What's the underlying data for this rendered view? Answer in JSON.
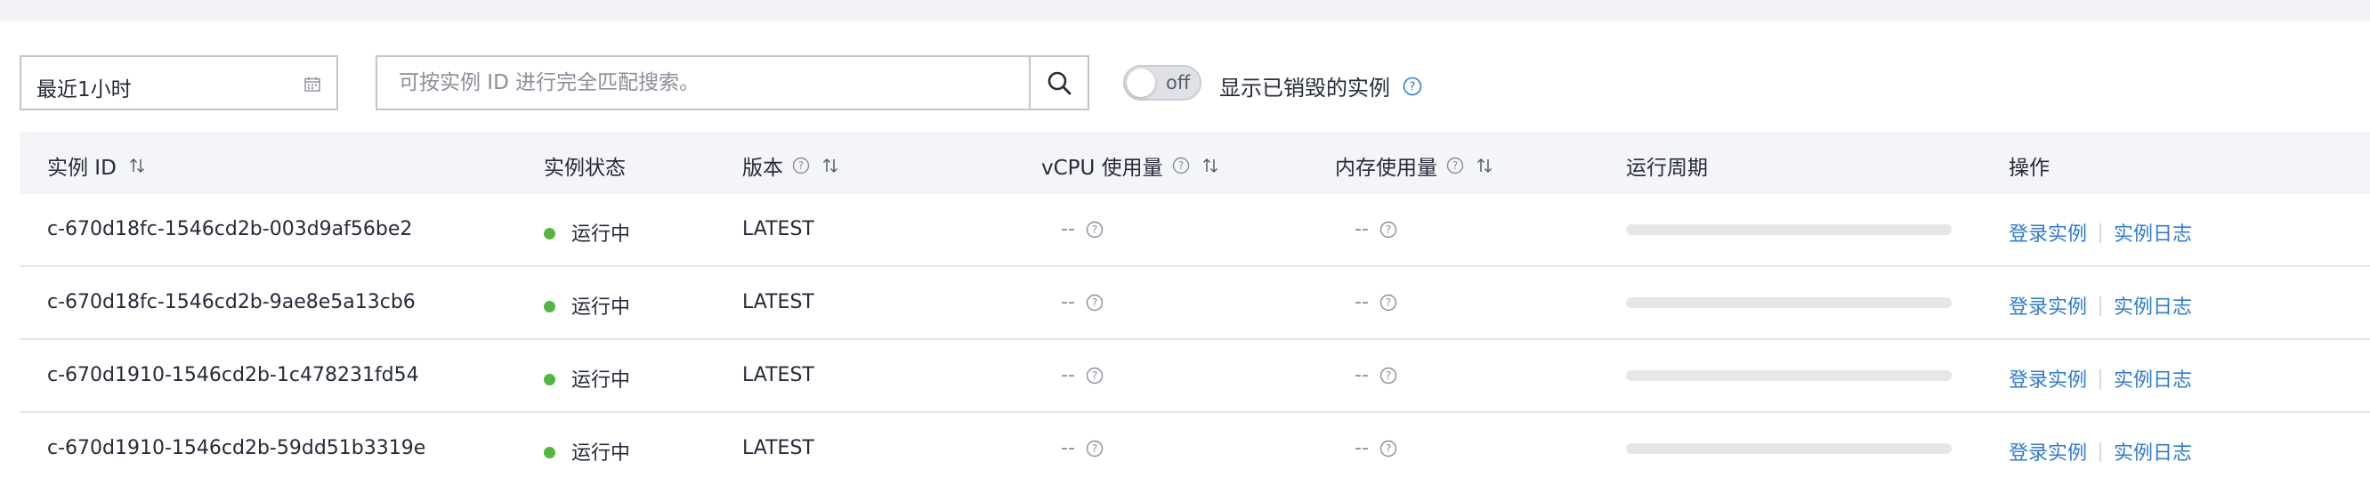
{
  "toolbar": {
    "time_range": "最近1小时",
    "search_placeholder": "可按实例 ID 进行完全匹配搜索。",
    "toggle_text": "off",
    "toggle_label": "显示已销毁的实例"
  },
  "table": {
    "headers": {
      "id": "实例 ID",
      "status": "实例状态",
      "version": "版本",
      "cpu": "vCPU 使用量",
      "memory": "内存使用量",
      "period": "运行周期",
      "actions": "操作"
    },
    "rows": [
      {
        "id": "c-670d18fc-1546cd2b-003d9af56be2",
        "status": "运行中",
        "version": "LATEST",
        "cpu": "--",
        "memory": "--",
        "login": "登录实例",
        "log": "实例日志"
      },
      {
        "id": "c-670d18fc-1546cd2b-9ae8e5a13cb6",
        "status": "运行中",
        "version": "LATEST",
        "cpu": "--",
        "memory": "--",
        "login": "登录实例",
        "log": "实例日志"
      },
      {
        "id": "c-670d1910-1546cd2b-1c478231fd54",
        "status": "运行中",
        "version": "LATEST",
        "cpu": "--",
        "memory": "--",
        "login": "登录实例",
        "log": "实例日志"
      },
      {
        "id": "c-670d1910-1546cd2b-59dd51b3319e",
        "status": "运行中",
        "version": "LATEST",
        "cpu": "--",
        "memory": "--",
        "login": "登录实例",
        "log": "实例日志"
      }
    ]
  },
  "colors": {
    "link": "#2e7ad6",
    "status_running": "#50b83c",
    "header_bg": "#f3f5f8"
  },
  "icons": [
    "calendar-icon",
    "search-icon",
    "help-icon",
    "sort-icon"
  ]
}
